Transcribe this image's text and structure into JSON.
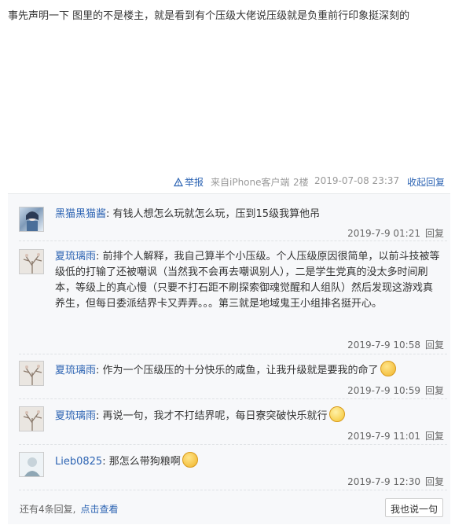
{
  "post": {
    "text": "事先声明一下 图里的不是楼主，就是看到有个压级大佬说压级就是负重前行印象挺深刻的"
  },
  "meta": {
    "report_label": "举报",
    "source": "来自iPhone客户端",
    "floor": "2楼",
    "time": "2019-07-08 23:37",
    "collapse_label": "收起回复"
  },
  "replies": [
    {
      "user": "黑猫黑猫酱",
      "text": ": 有钱人想怎么玩就怎么玩，压到15级我算他吊",
      "time": "2019-7-9 01:21",
      "reply_label": "回复"
    },
    {
      "user": "夏琉璃雨",
      "text": ": 前排个人解释，我自己算半个小压级。个人压级原因很简单，以前斗技被等级低的打输了还被嘲讽（当然我不会再去嘲讽别人），二是学生党真的没太多时间刷本，等级上的真心慢（只要不打石距不刷探索御魂觉醒和人组队）然后发现这游戏真养生，但每日委派结界卡又弄弄。。。第三就是地域鬼王小组排名挺开心。",
      "time": "2019-7-9 10:58",
      "reply_label": "回复"
    },
    {
      "user": "夏琉璃雨",
      "text": ": 作为一个压级压的十分快乐的咸鱼，让我升级就是要我的命了",
      "time": "2019-7-9 10:59",
      "reply_label": "回复"
    },
    {
      "user": "夏琉璃雨",
      "text": ": 再说一句，我才不打结界呢，每日寮突破快乐就行",
      "time": "2019-7-9 11:01",
      "reply_label": "回复"
    },
    {
      "user": "Lieb0825",
      "text": ": 那怎么带狗粮啊",
      "time": "2019-7-9 12:30",
      "reply_label": "回复"
    }
  ],
  "more": {
    "text": "还有4条回复,",
    "link": "点击查看"
  },
  "say_button": "我也说一句",
  "colors": {
    "link": "#2d64b3",
    "muted": "#999999",
    "reply_bg": "#f7f8fa"
  }
}
